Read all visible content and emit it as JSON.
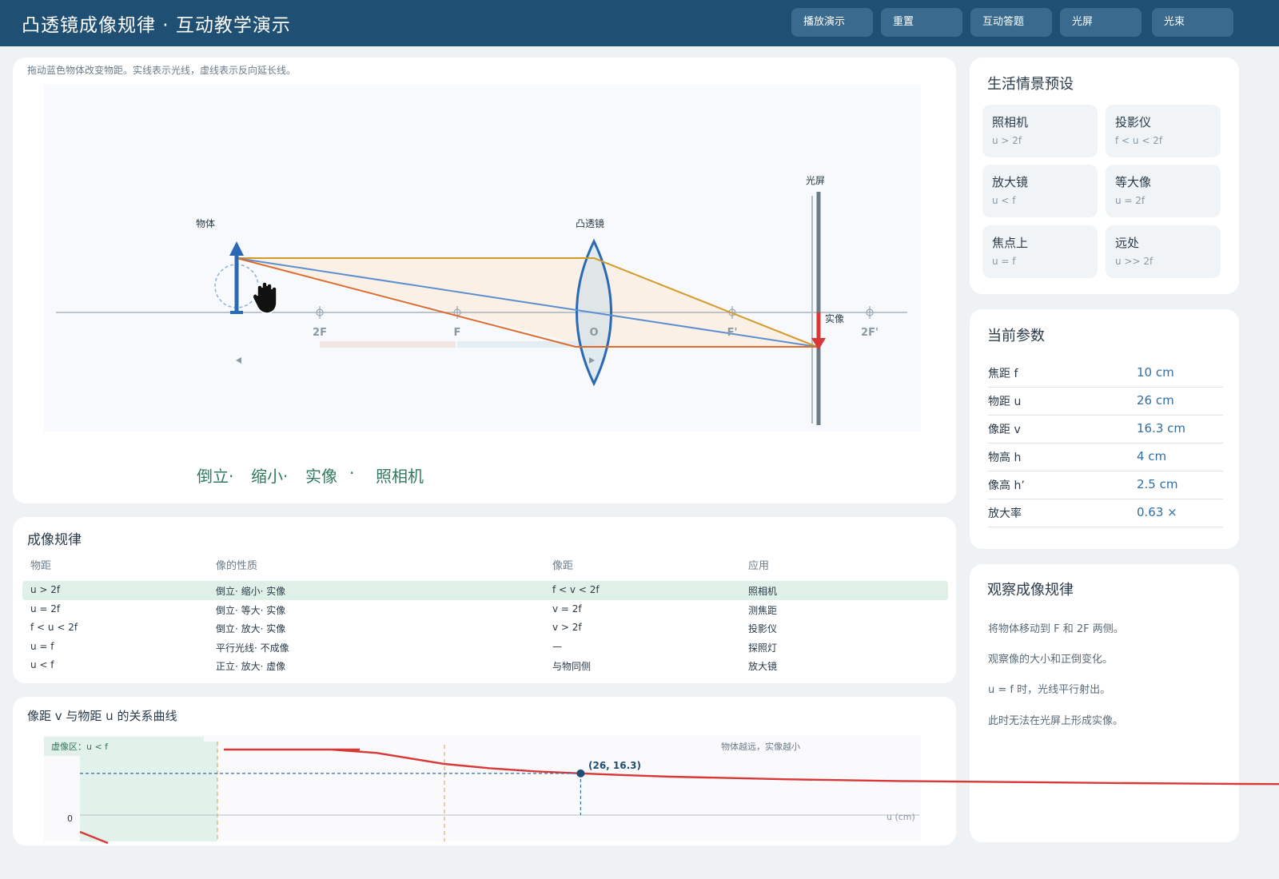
{
  "header": {
    "title": "凸透镜成像规律 · 互动教学演示",
    "buttons": [
      "播放演示",
      "重置",
      "互动答题",
      "光屏",
      "光束"
    ]
  },
  "sim": {
    "hint": "拖动蓝色物体改变物距。实线表示光线，虚线表示反向延长线。",
    "labels": {
      "object": "物体",
      "lens": "凸透镜",
      "screen": "光屏",
      "image": "实像",
      "marks": [
        "2F",
        "F",
        "O",
        "F'",
        "2F'"
      ]
    },
    "result": [
      "倒立·",
      "缩小·",
      "实像",
      "·",
      "照相机"
    ]
  },
  "presets": {
    "title": "生活情景预设",
    "items": [
      {
        "name": "照相机",
        "cond": "u > 2f"
      },
      {
        "name": "投影仪",
        "cond": "f < u < 2f"
      },
      {
        "name": "放大镜",
        "cond": "u < f"
      },
      {
        "name": "等大像",
        "cond": "u = 2f"
      },
      {
        "name": "焦点上",
        "cond": "u = f"
      },
      {
        "name": "远处",
        "cond": "u >> 2f"
      }
    ]
  },
  "params": {
    "title": "当前参数",
    "rows": [
      {
        "k": "焦距 f",
        "v": "10 cm"
      },
      {
        "k": "物距 u",
        "v": "26 cm"
      },
      {
        "k": "像距 v",
        "v": "16.3 cm"
      },
      {
        "k": "物高 h",
        "v": "4 cm"
      },
      {
        "k": "像高 h’",
        "v": "2.5 cm"
      },
      {
        "k": "放大率",
        "v": "0.63 ×"
      }
    ]
  },
  "rules": {
    "title": "成像规律",
    "headers": [
      "物距",
      "像的性质",
      "像距",
      "应用"
    ],
    "rows": [
      [
        "u > 2f",
        "倒立· 缩小· 实像",
        "f < v < 2f",
        "照相机"
      ],
      [
        "u = 2f",
        "倒立· 等大· 实像",
        "v = 2f",
        "测焦距"
      ],
      [
        "f < u < 2f",
        "倒立· 放大· 实像",
        "v > 2f",
        "投影仪"
      ],
      [
        "u = f",
        "平行光线· 不成像",
        "—",
        "探照灯"
      ],
      [
        "u < f",
        "正立· 放大· 虚像",
        "与物同侧",
        "放大镜"
      ]
    ],
    "highlight_row": 0
  },
  "curve": {
    "title": "像距 v 与物距 u 的关系曲线",
    "virtual_zone": "虚像区：u < f",
    "note": "物体越远，实像越小",
    "point_label": "(26, 16.3)",
    "y_zero": "0",
    "x_axis": "u (cm)"
  },
  "observe": {
    "title": "观察成像规律",
    "lines": [
      "将物体移动到 F 和 2F 两侧。",
      "观察像的大小和正倒变化。",
      "u = f 时，光线平行射出。",
      "此时无法在光屏上形成实像。"
    ]
  },
  "chart_data": {
    "type": "line",
    "title": "像距 v 与物距 u 的关系曲线",
    "xlabel": "u (cm)",
    "ylabel": "",
    "series": [
      {
        "x": [
          10.5,
          11,
          12,
          13,
          14,
          15,
          17,
          20,
          22,
          24,
          26,
          28,
          30,
          35,
          40
        ],
        "values": [
          210,
          110,
          60,
          43.3,
          35,
          30,
          24.3,
          20,
          18.3,
          17.1,
          16.3,
          15.6,
          15,
          14,
          13.3
        ]
      }
    ],
    "highlight_point": {
      "x": 26,
      "y": 16.3
    },
    "reference_lines_x": [
      10,
      20
    ]
  },
  "colors": {
    "header": "#1f4f73",
    "object": "#2a6ab5",
    "image": "#d93838",
    "ray1": "#d49a2a",
    "ray2": "#5b8fd0",
    "ray3": "#e06a2a",
    "lens": "#2a6ab5",
    "curve": "#d93838",
    "result": "#2f7a5c"
  },
  "icons": {
    "cursor": "hand-grab-icon",
    "focus_mark": "crosshair-icon"
  }
}
